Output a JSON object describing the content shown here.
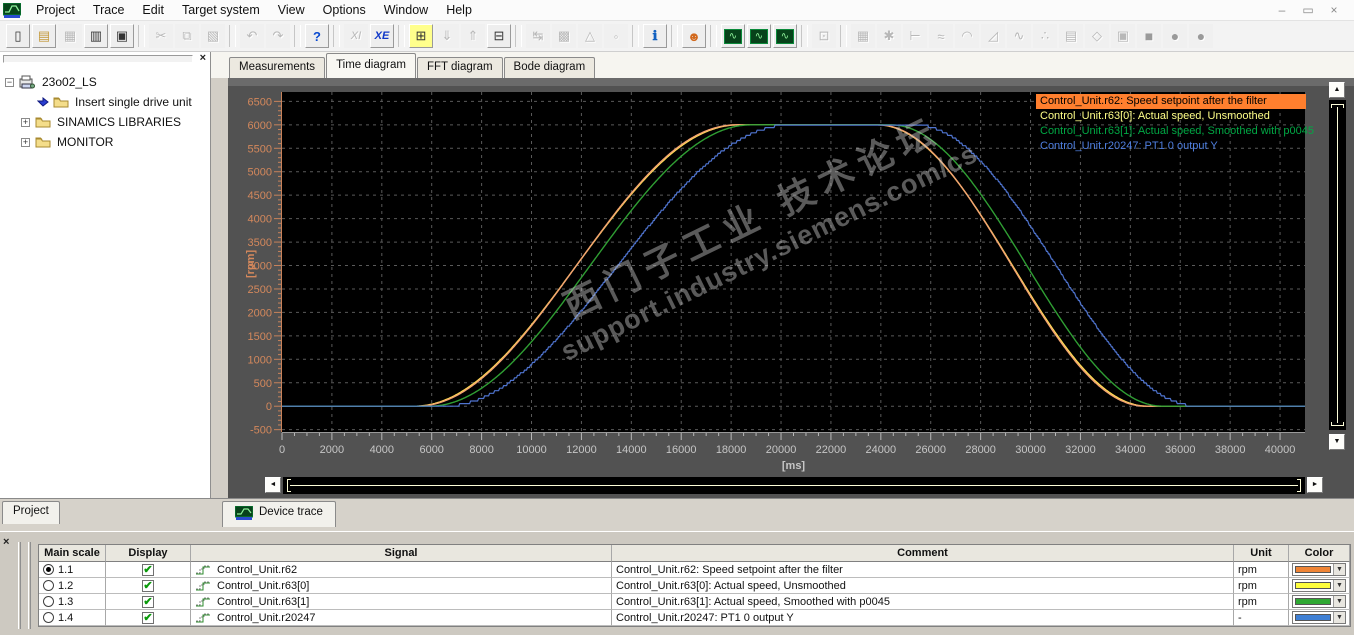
{
  "icons": {
    "close": "×",
    "scroll_left": "◄",
    "scroll_right": "►",
    "scroll_up": "▲",
    "scroll_down": "▼",
    "dropdown": "▼",
    "check": "✔",
    "collapse": "−",
    "expand": "+"
  },
  "menubar": {
    "items": [
      "Project",
      "Trace",
      "Edit",
      "Target system",
      "View",
      "Options",
      "Window",
      "Help"
    ]
  },
  "window_buttons": [
    {
      "name": "minimize-button",
      "glyph": "–"
    },
    {
      "name": "restore-button",
      "glyph": "▭"
    },
    {
      "name": "close-button",
      "glyph": "×"
    }
  ],
  "toolbar": {
    "groups": [
      {
        "items": [
          {
            "n": "new-project",
            "g": "▯"
          },
          {
            "n": "open-project",
            "g": "▤",
            "s": "gold"
          },
          {
            "n": "save",
            "g": "▦",
            "s": "dis"
          },
          {
            "n": "save-and-compile",
            "g": "▥"
          },
          {
            "n": "print",
            "g": "▣"
          }
        ]
      },
      {
        "items": [
          {
            "n": "cut",
            "g": "✂",
            "s": "dis"
          },
          {
            "n": "copy",
            "g": "⧉",
            "s": "dis"
          },
          {
            "n": "paste",
            "g": "▧",
            "s": "dis"
          }
        ]
      },
      {
        "items": [
          {
            "n": "undo",
            "g": "↶",
            "s": "dis"
          },
          {
            "n": "redo",
            "g": "↷",
            "s": "dis"
          }
        ]
      },
      {
        "items": [
          {
            "n": "help-cursor",
            "g": "?",
            "s": "help"
          }
        ]
      },
      {
        "items": [
          {
            "n": "cancel-internal",
            "g": "XI",
            "s": "dis xi"
          },
          {
            "n": "cancel-external",
            "g": "XE",
            "s": "xe"
          }
        ]
      },
      {
        "items": [
          {
            "n": "connect-target",
            "g": "⊞",
            "s": "ybg"
          },
          {
            "n": "download",
            "g": "⇓",
            "s": "dis"
          },
          {
            "n": "upload",
            "g": "⇑",
            "s": "dis"
          },
          {
            "n": "disconnect-target",
            "g": "⊟"
          }
        ]
      },
      {
        "items": [
          {
            "n": "insert-node",
            "g": "↹",
            "s": "dis"
          },
          {
            "n": "copy-ram-rom",
            "g": "▩",
            "s": "dis"
          },
          {
            "n": "load-to-pg",
            "g": "△",
            "s": "dis"
          },
          {
            "n": "compile",
            "g": "◦",
            "s": "dis"
          }
        ]
      },
      {
        "items": [
          {
            "n": "diagnostics-info",
            "g": "ℹ",
            "s": "blue"
          }
        ]
      },
      {
        "items": [
          {
            "n": "accessible-nodes",
            "g": "☻",
            "s": "warm"
          }
        ]
      },
      {
        "items": [
          {
            "n": "device-trace",
            "g": "∿",
            "s": "trace"
          },
          {
            "n": "function-generator",
            "g": "∿",
            "s": "trace"
          },
          {
            "n": "measuring-function",
            "g": "∿",
            "s": "trace"
          }
        ]
      },
      {
        "items": [
          {
            "n": "expert-list",
            "g": "⊡",
            "s": "dis"
          }
        ]
      },
      {
        "items": [
          {
            "n": "grid-view",
            "g": "▦",
            "s": "dis"
          },
          {
            "n": "configuration",
            "g": "✱",
            "s": "dis"
          },
          {
            "n": "limits",
            "g": "⊢",
            "s": "dis"
          },
          {
            "n": "smoothing",
            "g": "≈",
            "s": "dis"
          },
          {
            "n": "ramp-function",
            "g": "◠",
            "s": "dis"
          },
          {
            "n": "slope",
            "g": "◿",
            "s": "dis"
          },
          {
            "n": "setpoint-channel",
            "g": "∿",
            "s": "dis"
          },
          {
            "n": "fixed-values",
            "g": "∴",
            "s": "dis"
          },
          {
            "n": "signal-list",
            "g": "▤",
            "s": "dis"
          },
          {
            "n": "free-blocks",
            "g": "◇",
            "s": "dis"
          },
          {
            "n": "torque-limit",
            "g": "▣",
            "s": "dis"
          },
          {
            "n": "stop-square",
            "g": "■",
            "s": "dis shape"
          },
          {
            "n": "stop-circle-1",
            "g": "●",
            "s": "dis shape"
          },
          {
            "n": "stop-circle-2",
            "g": "●",
            "s": "dis shape"
          }
        ]
      }
    ]
  },
  "sidebar": {
    "bottom_tab": "Project",
    "tree": [
      {
        "id": "23o02_LS",
        "label": "23o02_LS",
        "expander": "minus",
        "indent": 0,
        "icons": [
          "drive-station"
        ]
      },
      {
        "id": "insert-single-drive-unit",
        "label": "Insert single drive unit",
        "indent": 1,
        "icons": [
          "insert-arrow",
          "folder"
        ]
      },
      {
        "id": "sinamics-libraries",
        "label": "SINAMICS LIBRARIES",
        "expander": "plus",
        "indent": 1,
        "icons": [
          "folder"
        ]
      },
      {
        "id": "monitor",
        "label": "MONITOR",
        "expander": "plus",
        "indent": 1,
        "icons": [
          "folder"
        ]
      }
    ]
  },
  "tabs": {
    "active": 1,
    "items": [
      "Measurements",
      "Time diagram",
      "FFT diagram",
      "Bode diagram"
    ]
  },
  "device_trace_tab": "Device trace",
  "watermark": {
    "line1": "西门子工业 技术论坛",
    "line2": "support.industry.siemens.com/cs"
  },
  "chart_data": {
    "type": "line",
    "title": "",
    "xlabel": "[ms]",
    "ylabel": "[rpm]",
    "xlim": [
      0,
      41000
    ],
    "ylim": [
      -550,
      6700
    ],
    "x_tick_min": 0,
    "x_tick_max": 40000,
    "x_tick_step": 2000,
    "y_tick_min": -500,
    "y_tick_max": 6500,
    "y_tick_step": 500,
    "grid": true,
    "plot_bg": "#000000",
    "frame_bg": "#525252",
    "legend_position": "top-right",
    "draw_order": [
      1,
      0,
      2,
      3
    ],
    "series": [
      {
        "name": "Control_Unit.r62",
        "legend": "Control_Unit.r62: Speed setpoint after the filter",
        "color": "#f2a272",
        "legend_bg": "#ff7f2e",
        "legend_fg": "#000000",
        "unit": "rpm",
        "amplitude_rpm": 6000,
        "ramp_ms": {
          "up_start": 5400,
          "up_end": 18200,
          "down_start": 23900,
          "down_end": 34600
        },
        "keypoints": [
          [
            0,
            0
          ],
          [
            5400,
            0
          ],
          [
            11800,
            3000
          ],
          [
            18200,
            6000
          ],
          [
            23900,
            6000
          ],
          [
            29250,
            3000
          ],
          [
            34600,
            0
          ],
          [
            41000,
            0
          ]
        ]
      },
      {
        "name": "Control_Unit.r63[0]",
        "legend": "Control_Unit.r63[0]: Actual speed, Unsmoothed",
        "color": "#ffdf52",
        "legend_fg": "#ffff88",
        "unit": "rpm",
        "amplitude_rpm": 6000,
        "ramp_ms": {
          "up_start": 5300,
          "up_end": 18300,
          "down_start": 23850,
          "down_end": 34700
        },
        "keypoints": [
          [
            0,
            0
          ],
          [
            5300,
            0
          ],
          [
            11800,
            3000
          ],
          [
            18300,
            6000
          ],
          [
            23850,
            6000
          ],
          [
            29275,
            3000
          ],
          [
            34700,
            0
          ],
          [
            41000,
            0
          ]
        ]
      },
      {
        "name": "Control_Unit.r63[1]",
        "legend": "Control_Unit.r63[1]: Actual speed, Smoothed with p0045",
        "color": "#2f9e33",
        "legend_fg": "#00a844",
        "unit": "rpm",
        "amplitude_rpm": 6000,
        "ramp_ms": {
          "up_start": 5900,
          "up_end": 18800,
          "down_start": 24400,
          "down_end": 35300
        },
        "keypoints": [
          [
            0,
            0
          ],
          [
            5900,
            0
          ],
          [
            12350,
            3000
          ],
          [
            18800,
            6000
          ],
          [
            24400,
            6000
          ],
          [
            29850,
            3000
          ],
          [
            35300,
            0
          ],
          [
            41000,
            0
          ]
        ]
      },
      {
        "name": "Control_Unit.r20247",
        "legend": "Control_Unit.r20247: PT1 0 output Y",
        "color": "#4f74cf",
        "legend_fg": "#4f7fe0",
        "unit": "-",
        "amplitude_rpm": 6000,
        "quantize_rpm": 55,
        "ramp_ms": {
          "up_start": 6500,
          "up_end": 20400,
          "down_start": 25350,
          "down_end": 36700
        },
        "keypoints": [
          [
            0,
            0
          ],
          [
            6500,
            0
          ],
          [
            13450,
            3000
          ],
          [
            20400,
            6000
          ],
          [
            25350,
            6000
          ],
          [
            31025,
            3000
          ],
          [
            36700,
            0
          ],
          [
            41000,
            0
          ]
        ]
      }
    ]
  },
  "table": {
    "headers": [
      "Main scale",
      "Display",
      "Signal",
      "Comment",
      "Unit",
      "Color"
    ],
    "rows": [
      {
        "scale": "1.1",
        "selected": true,
        "display": true,
        "signal": "Control_Unit.r62",
        "comment": "Control_Unit.r62: Speed setpoint after the filter",
        "unit": "rpm",
        "swatch": "#ef8435"
      },
      {
        "scale": "1.2",
        "selected": false,
        "display": true,
        "signal": "Control_Unit.r63[0]",
        "comment": "Control_Unit.r63[0]: Actual speed, Unsmoothed",
        "unit": "rpm",
        "swatch": "#ffff3d"
      },
      {
        "scale": "1.3",
        "selected": false,
        "display": true,
        "signal": "Control_Unit.r63[1]",
        "comment": "Control_Unit.r63[1]: Actual speed, Smoothed with p0045",
        "unit": "rpm",
        "swatch": "#2fa833"
      },
      {
        "scale": "1.4",
        "selected": false,
        "display": true,
        "signal": "Control_Unit.r20247",
        "comment": "Control_Unit.r20247: PT1 0 output Y",
        "unit": "-",
        "swatch": "#4080d4"
      }
    ]
  }
}
